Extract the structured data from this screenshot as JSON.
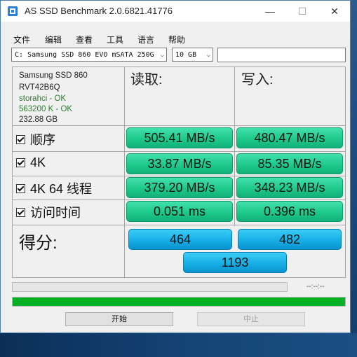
{
  "window": {
    "title": "AS SSD Benchmark 2.0.6821.41776",
    "minimize_glyph": "—",
    "maximize_glyph": "☐",
    "close_glyph": "✕"
  },
  "menu": [
    "文件",
    "编辑",
    "查看",
    "工具",
    "语言",
    "帮助"
  ],
  "toolbar": {
    "drive_value": "C: Samsung SSD 860 EVO mSATA 250G",
    "size_value": "10 GB",
    "dropdown_arrow": "⌵",
    "name_value": ""
  },
  "drive_info": {
    "model": "Samsung SSD 860",
    "firmware": "RVT42B6Q",
    "driver": "storahci - OK",
    "alignment": "563200 K - OK",
    "capacity": "232.88 GB"
  },
  "columns": {
    "read": "读取:",
    "write": "写入:"
  },
  "rows": [
    {
      "label": "顺序",
      "read": "505.41 MB/s",
      "write": "480.47 MB/s"
    },
    {
      "label": "4K",
      "read": "33.87 MB/s",
      "write": "85.35 MB/s"
    },
    {
      "label": "4K 64 线程",
      "read": "379.20 MB/s",
      "write": "348.23 MB/s"
    },
    {
      "label": "访问时间",
      "read": "0.051 ms",
      "write": "0.396 ms"
    }
  ],
  "score": {
    "label": "得分:",
    "read": "464",
    "write": "482",
    "total": "1193"
  },
  "progress": {
    "time_text": "--:--:--",
    "main_fraction": 1.0
  },
  "buttons": {
    "start": "开始",
    "stop": "中止"
  },
  "colors": {
    "result_green": "#1ec98c",
    "score_blue": "#16aee6",
    "progress_green": "#06b025"
  }
}
